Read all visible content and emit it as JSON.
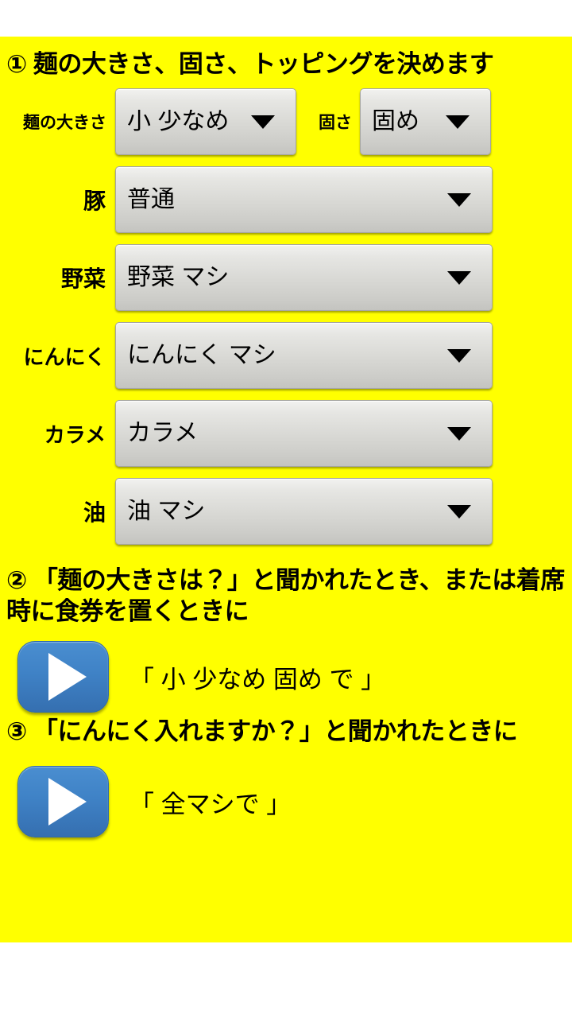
{
  "app": {
    "background_color": "#ffff00",
    "text_color": "#000000",
    "button_color": "#3f82c6"
  },
  "sections": {
    "step1": {
      "heading": "① 麺の大きさ、固さ、トッピングを決めます"
    },
    "step2": {
      "heading": "② 「麺の大きさは？」と聞かれたとき、または着席時に食券を置くときに",
      "play_label": "play-button",
      "caption": "「 小 少なめ 固め で 」"
    },
    "step3": {
      "heading": "③ 「にんにく入れますか？」と聞かれたときに",
      "play_label": "play-button",
      "caption": "「 全マシで 」"
    }
  },
  "form": {
    "noodle_size": {
      "label": "麺の大きさ",
      "value": "小 少なめ",
      "caret": "chevron-down-icon"
    },
    "firmness": {
      "label": "固さ",
      "value": "固め",
      "caret": "chevron-down-icon"
    },
    "pork": {
      "label": "豚",
      "value": "普通",
      "caret": "chevron-down-icon"
    },
    "vegetables": {
      "label": "野菜",
      "value": "野菜 マシ",
      "caret": "chevron-down-icon"
    },
    "garlic": {
      "label": "にんにく",
      "value": "にんにく マシ",
      "caret": "chevron-down-icon"
    },
    "karame": {
      "label": "カラメ",
      "value": "カラメ",
      "caret": "chevron-down-icon"
    },
    "oil": {
      "label": "油",
      "value": "油 マシ",
      "caret": "chevron-down-icon"
    }
  }
}
